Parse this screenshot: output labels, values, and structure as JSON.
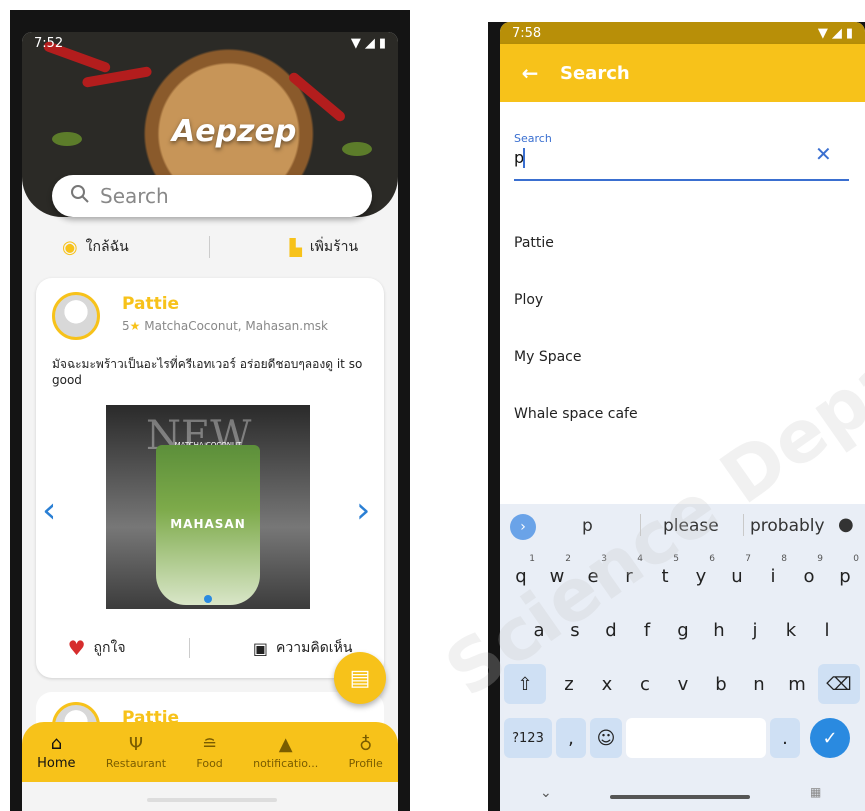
{
  "phone1": {
    "status_time": "7:52",
    "app_title": "Aepzep",
    "search_placeholder": "Search",
    "quick_actions": [
      "ใกล้ฉัน",
      "เพิ่มร้าน"
    ],
    "post": {
      "author": "Pattie",
      "rating": "5",
      "meta": "MatchaCoconut, Mahasan.msk",
      "text": "มัจฉะมะพร้าวเป็นอะไรที่ครีเอทเวอร์ อร่อยดีชอบๆลองดู it so good",
      "image_headline": "NEW",
      "image_tag": "MATCHA COCONUT",
      "image_brand": "MAHASAN"
    },
    "actions": {
      "like": "ถูกใจ",
      "comment": "ความคิดเห็น"
    },
    "next_post_author": "Pattie",
    "bottom_nav": [
      {
        "label": "Home",
        "icon": "home-icon",
        "active": true
      },
      {
        "label": "Restaurant",
        "icon": "utensils-icon",
        "active": false
      },
      {
        "label": "Food",
        "icon": "food-icon",
        "active": false
      },
      {
        "label": "notificatio...",
        "icon": "bell-icon",
        "active": false
      },
      {
        "label": "Profile",
        "icon": "profile-icon",
        "active": false
      }
    ],
    "accent": "#f7c21a"
  },
  "phone2": {
    "status_time": "7:58",
    "appbar_title": "Search",
    "field_label": "Search",
    "field_value": "p",
    "results": [
      "Pattie",
      "Ploy",
      "My Space",
      "Whale space cafe"
    ],
    "suggestions": [
      "p",
      "please",
      "probably"
    ],
    "keyboard_rows": [
      [
        {
          "k": "q",
          "n": "1"
        },
        {
          "k": "w",
          "n": "2"
        },
        {
          "k": "e",
          "n": "3"
        },
        {
          "k": "r",
          "n": "4"
        },
        {
          "k": "t",
          "n": "5"
        },
        {
          "k": "y",
          "n": "6"
        },
        {
          "k": "u",
          "n": "7"
        },
        {
          "k": "i",
          "n": "8"
        },
        {
          "k": "o",
          "n": "9"
        },
        {
          "k": "p",
          "n": "0"
        }
      ],
      [
        {
          "k": "a"
        },
        {
          "k": "s"
        },
        {
          "k": "d"
        },
        {
          "k": "f"
        },
        {
          "k": "g"
        },
        {
          "k": "h"
        },
        {
          "k": "j"
        },
        {
          "k": "k"
        },
        {
          "k": "l"
        }
      ],
      [
        {
          "k": "z"
        },
        {
          "k": "x"
        },
        {
          "k": "c"
        },
        {
          "k": "v"
        },
        {
          "k": "b"
        },
        {
          "k": "n"
        },
        {
          "k": "m"
        }
      ]
    ],
    "key_labels": {
      "symbols": "?123",
      "comma": ",",
      "period": "."
    },
    "accent": "#f7c21a"
  }
}
